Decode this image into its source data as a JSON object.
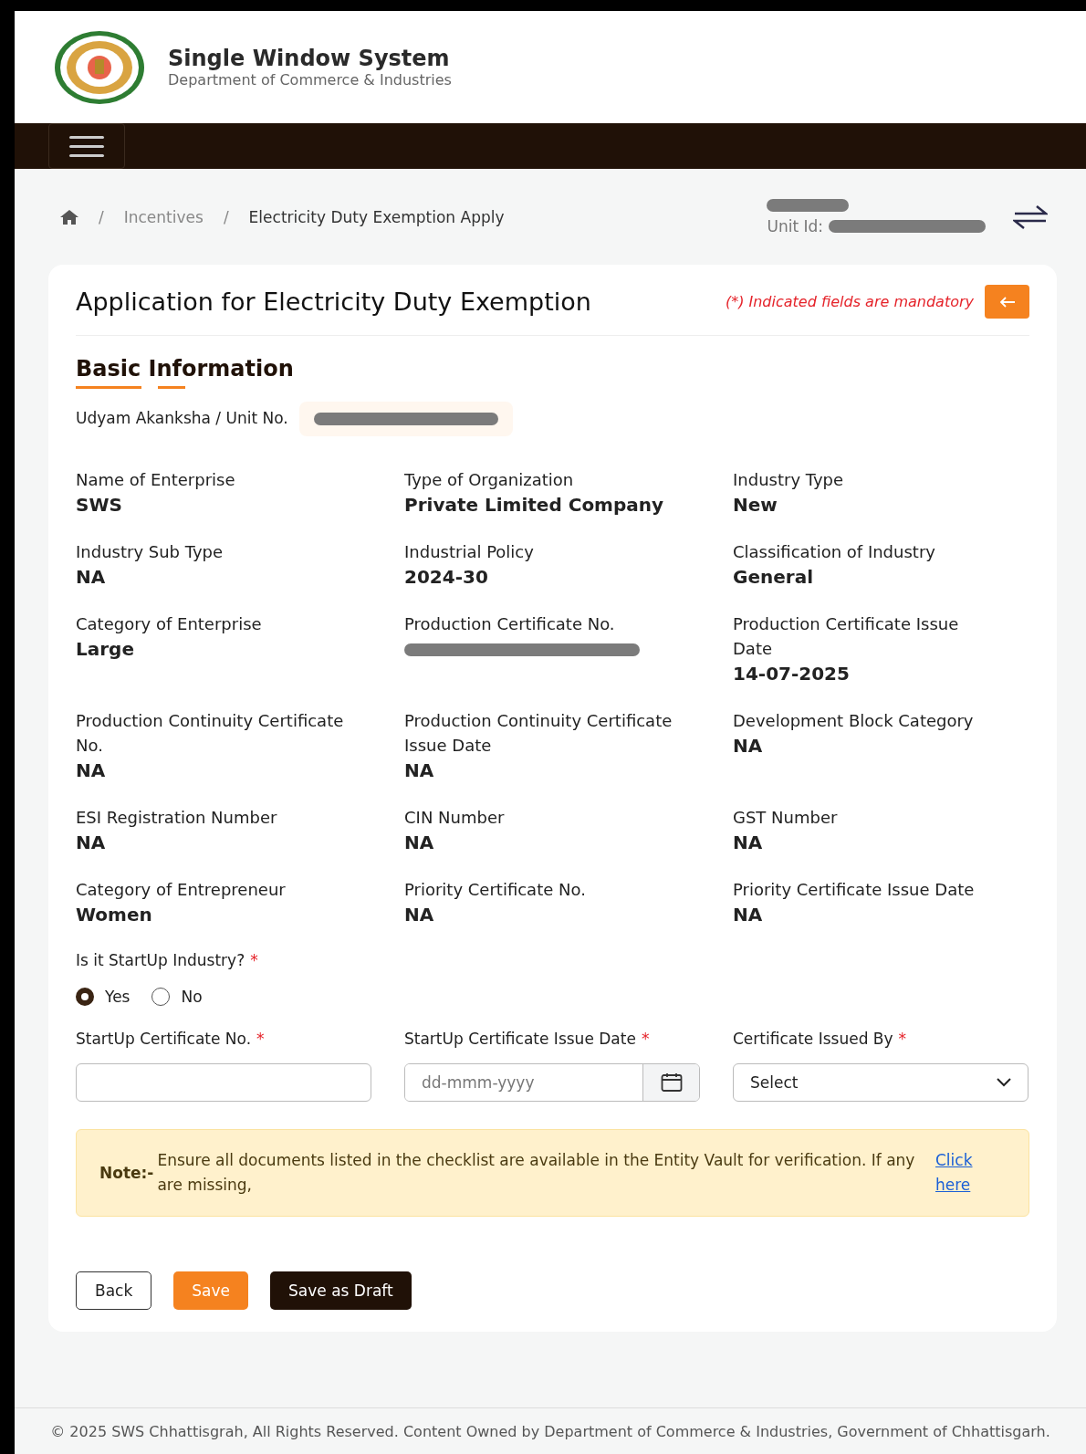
{
  "header": {
    "title": "Single Window System",
    "subtitle": "Department of Commerce & Industries"
  },
  "breadcrumb": {
    "items": [
      {
        "separator": "/",
        "label": "Incentives"
      },
      {
        "separator": "/",
        "label": "Electricity Duty Exemption Apply"
      }
    ]
  },
  "unit": {
    "label": "Unit Id:"
  },
  "card": {
    "title": "Application for Electricity Duty Exemption",
    "mandatory_note": "(*) Indicated fields are mandatory"
  },
  "section": {
    "title": "Basic Information",
    "udyam_label": "Udyam Akanksha / Unit No."
  },
  "details": [
    {
      "label": "Name of Enterprise",
      "value": "SWS"
    },
    {
      "label": "Type of Organization",
      "value": "Private Limited Company"
    },
    {
      "label": "Industry Type",
      "value": "New"
    },
    {
      "label": "Industry Sub Type",
      "value": "NA"
    },
    {
      "label": "Industrial Policy",
      "value": "2024-30"
    },
    {
      "label": "Classification of Industry",
      "value": "General"
    },
    {
      "label": "Category of Enterprise",
      "value": "Large"
    },
    {
      "label": "Production Certificate No.",
      "kind": "redacted"
    },
    {
      "label": "Production Certificate Issue Date",
      "value": "14-07-2025"
    },
    {
      "label": "Production Continuity Certificate No.",
      "value": "NA"
    },
    {
      "label": "Production Continuity Certificate Issue Date",
      "value": "NA"
    },
    {
      "label": "Development Block Category",
      "value": "NA"
    },
    {
      "label": "ESI Registration Number",
      "value": "NA"
    },
    {
      "label": "CIN Number",
      "value": "NA"
    },
    {
      "label": "GST Number",
      "value": "NA"
    },
    {
      "label": "Category of Entrepreneur",
      "value": "Women"
    },
    {
      "label": "Priority Certificate No.",
      "value": "NA"
    },
    {
      "label": "Priority Certificate Issue Date",
      "value": "NA"
    }
  ],
  "startup": {
    "question": "Is it StartUp Industry?",
    "required_mark": "*",
    "options": [
      {
        "label": "Yes",
        "selected": true
      },
      {
        "label": "No",
        "selected": false
      }
    ]
  },
  "inputs": [
    {
      "kind": "text",
      "label": "StartUp Certificate No.",
      "required_mark": "*"
    },
    {
      "kind": "date",
      "label": "StartUp Certificate Issue Date",
      "required_mark": "*",
      "placeholder": "dd-mmm-yyyy"
    },
    {
      "kind": "select",
      "label": "Certificate Issued By",
      "required_mark": "*",
      "value": "Select"
    }
  ],
  "note": {
    "label": "Note:-",
    "text": "Ensure all documents listed in the checklist are available in the Entity Vault for verification. If any are missing,",
    "link": "Click here"
  },
  "buttons": [
    {
      "kind": "outline",
      "label": "Back"
    },
    {
      "kind": "primary",
      "label": "Save"
    },
    {
      "kind": "dark",
      "label": "Save as Draft"
    }
  ],
  "footer": {
    "text": "© 2025 SWS Chhattisgrah, All Rights Reserved. Content Owned by Department of Commerce & Industries, Government of Chhattisgarh."
  }
}
